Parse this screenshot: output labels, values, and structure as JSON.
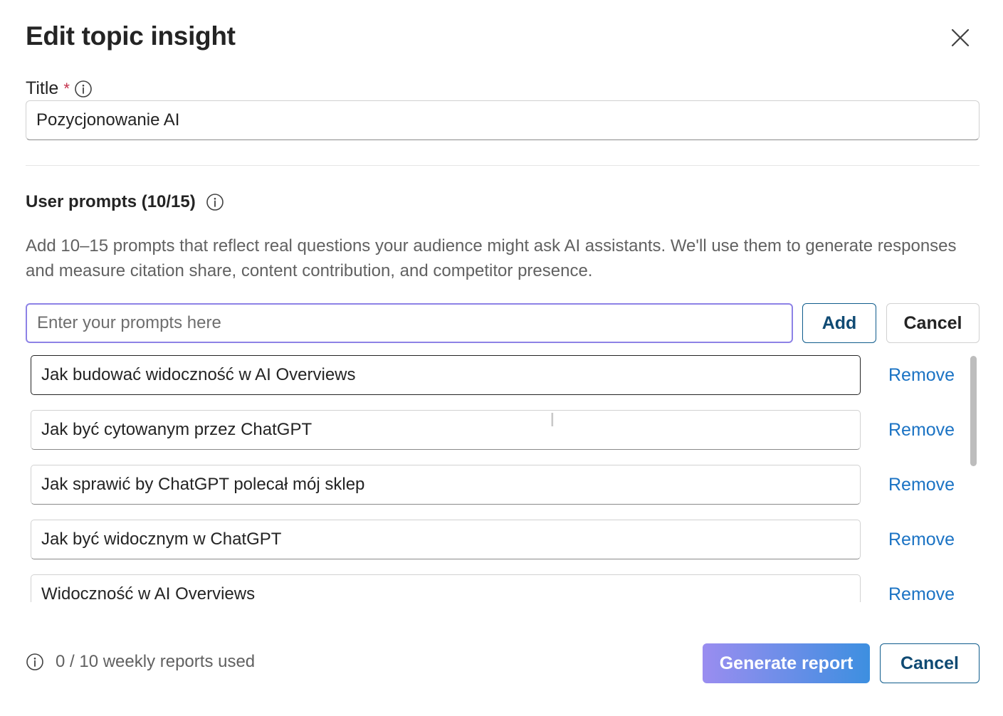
{
  "dialog": {
    "title": "Edit topic insight",
    "close_icon": "close-icon"
  },
  "title_field": {
    "label": "Title",
    "required_marker": "*",
    "info_icon": "info-icon",
    "value": "Pozycjonowanie AI"
  },
  "prompts_section": {
    "heading": "User prompts (10/15)",
    "info_icon": "info-icon",
    "description": "Add 10–15 prompts that reflect real questions your audience might ask AI assistants. We'll use them to generate responses and measure citation share, content contribution, and competitor presence.",
    "input_placeholder": "Enter your prompts here",
    "add_label": "Add",
    "cancel_label": "Cancel",
    "remove_label": "Remove",
    "items": [
      {
        "text": "Jak budować widoczność w AI Overviews"
      },
      {
        "text": "Jak być cytowanym przez ChatGPT"
      },
      {
        "text": "Jak sprawić by ChatGPT polecał mój sklep"
      },
      {
        "text": "Jak być widocznym w ChatGPT"
      },
      {
        "text": "Widoczność w AI Overviews"
      }
    ]
  },
  "footer": {
    "info_icon": "info-icon",
    "usage_text": "0 / 10 weekly reports used",
    "generate_label": "Generate report",
    "cancel_label": "Cancel"
  },
  "colors": {
    "link": "#1b73c4",
    "focus_border": "#8d82e6",
    "primary_gradient_start": "#9a8df0",
    "primary_gradient_end": "#3d8fe0",
    "required": "#c4314b"
  }
}
